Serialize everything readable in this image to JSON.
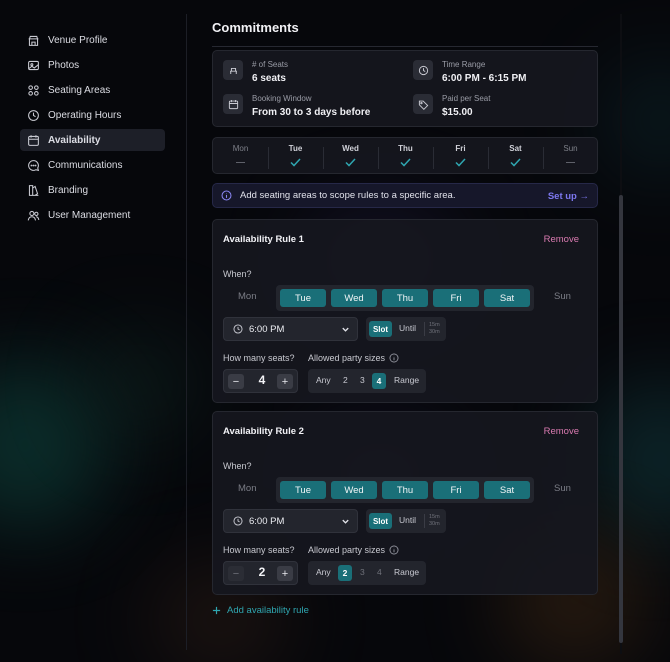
{
  "sidebar": {
    "items": [
      {
        "label": "Venue Profile",
        "icon": "store-icon",
        "active": false
      },
      {
        "label": "Photos",
        "icon": "image-icon",
        "active": false
      },
      {
        "label": "Seating Areas",
        "icon": "grid-icon",
        "active": false
      },
      {
        "label": "Operating Hours",
        "icon": "clock-icon",
        "active": false
      },
      {
        "label": "Availability",
        "icon": "calendar-icon",
        "active": true
      },
      {
        "label": "Communications",
        "icon": "chat-icon",
        "active": false
      },
      {
        "label": "Branding",
        "icon": "palette-icon",
        "active": false
      },
      {
        "label": "User Management",
        "icon": "users-icon",
        "active": false
      }
    ]
  },
  "main": {
    "title": "Commitments",
    "summary": {
      "seats_label": "# of Seats",
      "seats_value": "6 seats",
      "time_label": "Time Range",
      "time_value": "6:00 PM - 6:15 PM",
      "window_label": "Booking Window",
      "window_value": "From 30 to 3 days before",
      "paid_label": "Paid per Seat",
      "paid_value": "$15.00"
    },
    "week": [
      {
        "day": "Mon",
        "on": false
      },
      {
        "day": "Tue",
        "on": true
      },
      {
        "day": "Wed",
        "on": true
      },
      {
        "day": "Thu",
        "on": true
      },
      {
        "day": "Fri",
        "on": true
      },
      {
        "day": "Sat",
        "on": true
      },
      {
        "day": "Sun",
        "on": false
      }
    ],
    "banner": {
      "text": "Add seating areas to scope rules to a specific area.",
      "link": "Set up →"
    },
    "rules": [
      {
        "title": "Availability Rule 1",
        "remove": "Remove",
        "when": "When?",
        "day_off_start": "Mon",
        "days": [
          "Tue",
          "Wed",
          "Thu",
          "Fri",
          "Sat"
        ],
        "day_off_end": "Sun",
        "time": "6:00 PM",
        "slot": "Slot",
        "until": "Until",
        "mins_a": "15m",
        "mins_b": "30m",
        "seats_q": "How many seats?",
        "seats": "4",
        "minus": "−",
        "plus": "+",
        "party_q": "Allowed party sizes",
        "party": [
          "Any",
          "2",
          "3",
          "4",
          "Range"
        ],
        "party_selected": "4"
      },
      {
        "title": "Availability Rule 2",
        "remove": "Remove",
        "when": "When?",
        "day_off_start": "Mon",
        "days": [
          "Tue",
          "Wed",
          "Thu",
          "Fri",
          "Sat"
        ],
        "day_off_end": "Sun",
        "time": "6:00 PM",
        "slot": "Slot",
        "until": "Until",
        "mins_a": "15m",
        "mins_b": "30m",
        "seats_q": "How many seats?",
        "seats": "2",
        "minus": "−",
        "plus": "+",
        "party_q": "Allowed party sizes",
        "party": [
          "Any",
          "2",
          "3",
          "4",
          "Range"
        ],
        "party_selected": "2"
      }
    ],
    "add_rule": "Add availability rule"
  },
  "colors": {
    "accent": "#1a6f78",
    "link": "#7d78f0",
    "remove": "#d97ab0",
    "add": "#2fa6b0"
  }
}
